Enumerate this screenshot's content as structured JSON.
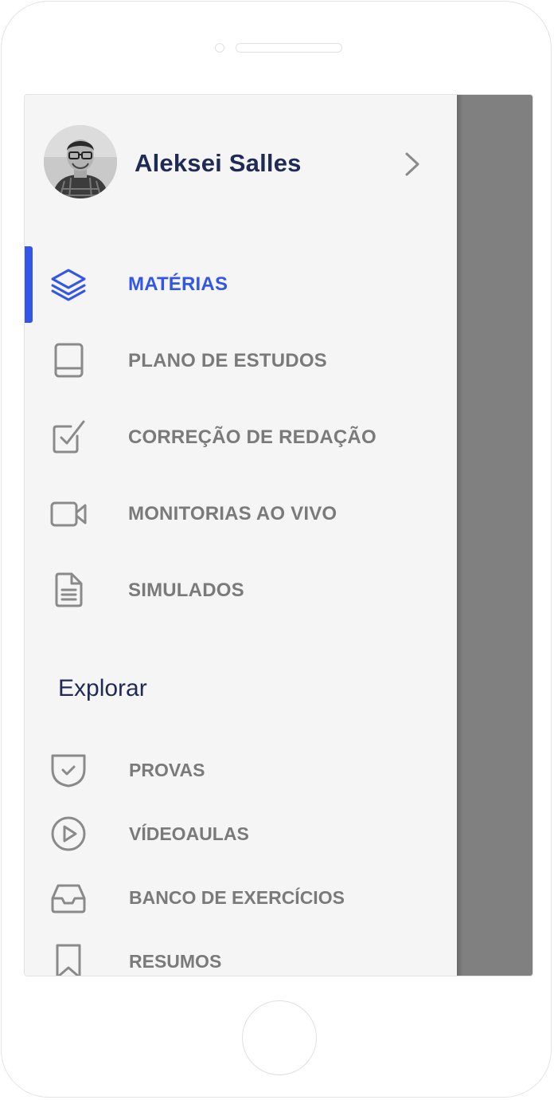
{
  "profile": {
    "name": "Aleksei Salles"
  },
  "menu": {
    "items": [
      {
        "label": "MATÉRIAS",
        "icon": "layers-icon",
        "active": true
      },
      {
        "label": "PLANO DE ESTUDOS",
        "icon": "book-icon"
      },
      {
        "label": "CORREÇÃO DE REDAÇÃO",
        "icon": "checkbox-icon"
      },
      {
        "label": "MONITORIAS AO VIVO",
        "icon": "video-camera-icon"
      },
      {
        "label": "SIMULADOS",
        "icon": "document-icon"
      }
    ]
  },
  "explore": {
    "title": "Explorar",
    "items": [
      {
        "label": "PROVAS",
        "icon": "shield-check-icon"
      },
      {
        "label": "VÍDEOAULAS",
        "icon": "play-circle-icon"
      },
      {
        "label": "BANCO DE EXERCÍCIOS",
        "icon": "inbox-icon"
      },
      {
        "label": "RESUMOS",
        "icon": "bookmark-icon"
      }
    ]
  },
  "colors": {
    "accent": "#3355e8",
    "text_muted": "#7a7a7a",
    "title": "#1f2a55",
    "background": "#f5f5f5",
    "overlay": "#808080"
  }
}
